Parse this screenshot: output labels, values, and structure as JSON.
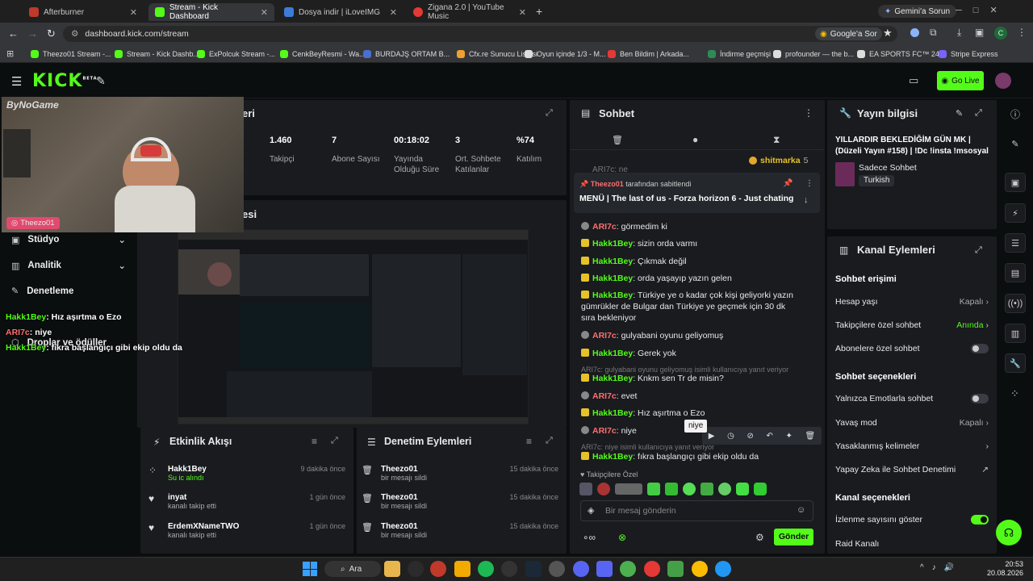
{
  "tabs": [
    {
      "label": "Afterburner",
      "color": "#c0392b"
    },
    {
      "label": "Stream - Kick Dashboard",
      "color": "#53fc18"
    },
    {
      "label": "Dosya indir | iLoveIMG",
      "color": "#3d7bd9"
    },
    {
      "label": "Zigana 2.0 | YouTube Music",
      "color": "#e53935"
    }
  ],
  "gemini_label": "Gemini'a Sorun",
  "url": "dashboard.kick.com/stream",
  "google_ask": "Google'a Sor",
  "bookmarks": [
    "Theezo01 Stream -...",
    "Stream - Kick Dashb...",
    "ExPolcuk Stream -...",
    "CenkBeyResmi - Wa...",
    "BURDAJŞ ORTAM B...",
    "Cfx.re Sunucu Listesi",
    "Oyun içinde 1/3 - M...",
    "Ben Bildim | Arkada...",
    "İndirme geçmişi",
    "profounder — the b...",
    "EA SPORTS FC™ 24...",
    "Stripe Express"
  ],
  "header": {
    "logo": "KICK",
    "logo_sup": "BETA",
    "go_live": "Go Live"
  },
  "webcam": {
    "watermark": "ByNoGame",
    "streamer": "Theezo01"
  },
  "left_nav": [
    {
      "label": "Stüdyo"
    },
    {
      "label": "Analitik"
    },
    {
      "label": "Denetleme"
    },
    {
      "label": "Droplar ve ödüller"
    }
  ],
  "overlay_chat": [
    {
      "user": "Hakk1Bey",
      "text": "Hız aşırtma o Ezo"
    },
    {
      "user": "ARI7c",
      "text": "niye"
    },
    {
      "user": "Hakk1Bey",
      "text": "fıkra başlangıçı gibi ekip oldu da"
    }
  ],
  "stats_partial_title": "eri",
  "preview_partial_title": "esi",
  "stats": [
    {
      "value": "1.460",
      "label": "Takipçi"
    },
    {
      "value": "7",
      "label": "Abone Sayısı"
    },
    {
      "value": "00:18:02",
      "label": "Yayında Olduğu Süre"
    },
    {
      "value": "3",
      "label": "Ort. Sohbete Katılanlar"
    },
    {
      "value": "%74",
      "label": "Katılım"
    }
  ],
  "activity": {
    "title": "Etkinlik Akışı",
    "items": [
      {
        "name": "Hakk1Bey",
        "sub": "Su ic alındı",
        "time": "9 dakika önce",
        "sub_green": true
      },
      {
        "name": "inyat",
        "sub": "kanalı takip etti",
        "time": "1 gün önce"
      },
      {
        "name": "ErdemXNameTWO",
        "sub": "kanalı takip etti",
        "time": "1 gün önce"
      }
    ]
  },
  "moderation": {
    "title": "Denetim Eylemleri",
    "items": [
      {
        "name": "Theezo01",
        "sub": "bir mesajı sildi",
        "time": "15 dakika önce"
      },
      {
        "name": "Theezo01",
        "sub": "bir mesajı sildi",
        "time": "15 dakika önce"
      },
      {
        "name": "Theezo01",
        "sub": "bir mesajı sildi",
        "time": "15 dakika önce"
      }
    ]
  },
  "chat": {
    "title": "Sohbet",
    "top_gifter": "shitmarka",
    "top_gifter_count": "5",
    "cut_row": "ARI7c: ne",
    "pinned_by_user": "Theezo01",
    "pinned_by_text": "tarafından sabitlendi",
    "pinned_msg": "MENÜ | The last of us - Forza horizon 6 - Just chating",
    "messages": [
      {
        "user": "ARI7c",
        "text": "görmedim ki",
        "type": "b2"
      },
      {
        "user": "Hakk1Bey",
        "text": "sizin orda varmı",
        "type": "b1"
      },
      {
        "user": "Hakk1Bey",
        "text": "Çıkmak değil",
        "type": "b1"
      },
      {
        "user": "Hakk1Bey",
        "text": "orda yaşayıp yazın gelen",
        "type": "b1"
      },
      {
        "user": "Hakk1Bey",
        "text": "Türkiye ye o kadar çok kişi geliyorki yazın gümrükler de Bulgar dan Türkiye ye geçmek için 30 dk sıra bekleniyor",
        "type": "b1"
      },
      {
        "user": "ARI7c",
        "text": "gulyabani oyunu geliyomuş",
        "type": "b2"
      },
      {
        "user": "Hakk1Bey",
        "text": "Gerek yok",
        "type": "b1"
      },
      {
        "user": "",
        "text": "ARI7c: gulyabani oyunu geliyomuş isimli kullanıcıya yanıt veriyor",
        "type": "reply"
      },
      {
        "user": "Hakk1Bey",
        "text": "Knkm sen Tr de misin?",
        "type": "b1"
      },
      {
        "user": "ARI7c",
        "text": "evet",
        "type": "b2"
      },
      {
        "user": "Hakk1Bey",
        "text": "Hız aşırtma o Ezo",
        "type": "b1"
      },
      {
        "user": "ARI7c",
        "text": "niye",
        "type": "b2"
      },
      {
        "user": "",
        "text": "ARI7c: niye isimli kullanıcıya yanıt veriyor",
        "type": "reply"
      },
      {
        "user": "Hakk1Bey",
        "text": "fıkra başlangıçı gibi ekip oldu da",
        "type": "b1"
      }
    ],
    "tooltip": "niye",
    "followers_only": "Takipçilere Özel",
    "input_placeholder": "Bir mesaj gönderin",
    "send": "Gönder"
  },
  "stream_info": {
    "title": "Yayın bilgisi",
    "stream_title": "YILLARDIR BEKLEDİĞİM GÜN MK | (Düzeli Yayın #158) | !Dc !insta !msosyal !Donat...",
    "category": "Sadece Sohbet",
    "tag": "Turkish"
  },
  "channel_actions": {
    "title": "Kanal Eylemleri",
    "sec1": "Sohbet erişimi",
    "account_age": "Hesap yaşı",
    "account_age_val": "Kapalı",
    "followers_only": "Takipçilere özel sohbet",
    "followers_only_val": "Anında",
    "subs_only": "Abonelere özel sohbet",
    "sec2": "Sohbet seçenekleri",
    "emotes_only": "Yalnızca Emotlarla sohbet",
    "slow_mode": "Yavaş mod",
    "slow_mode_val": "Kapalı",
    "banned_words": "Yasaklanmış kelimeler",
    "ai_mod": "Yapay Zeka ile Sohbet Denetimi",
    "sec3": "Kanal seçenekleri",
    "show_viewers": "İzlenme sayısını göster",
    "raid": "Raid Kanalı"
  },
  "taskbar": {
    "search": "Ara",
    "time": "20:53",
    "date": "20.08.2026"
  }
}
